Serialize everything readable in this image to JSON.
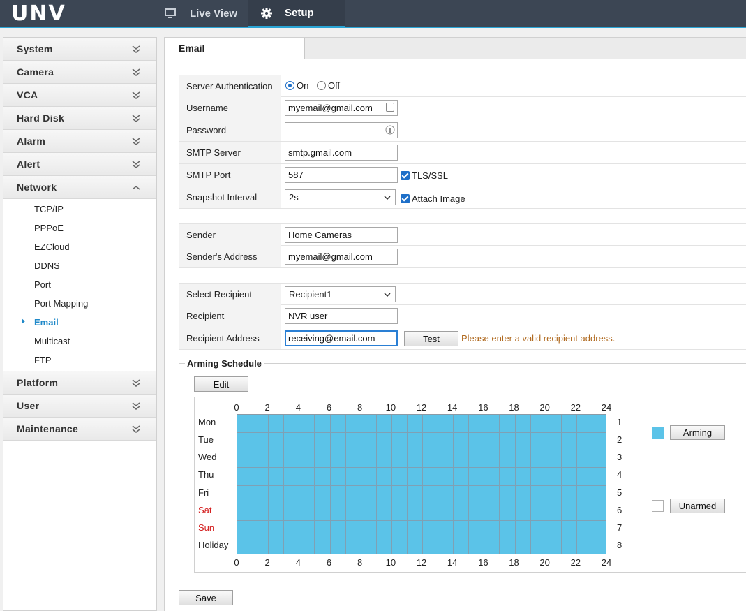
{
  "brand": "UNV",
  "topnav": {
    "live_view": "Live View",
    "setup": "Setup"
  },
  "sidebar": {
    "sections": [
      {
        "label": "System",
        "expanded": false
      },
      {
        "label": "Camera",
        "expanded": false
      },
      {
        "label": "VCA",
        "expanded": false
      },
      {
        "label": "Hard Disk",
        "expanded": false
      },
      {
        "label": "Alarm",
        "expanded": false
      },
      {
        "label": "Alert",
        "expanded": false
      },
      {
        "label": "Network",
        "expanded": true
      }
    ],
    "network_items": [
      "TCP/IP",
      "PPPoE",
      "EZCloud",
      "DDNS",
      "Port",
      "Port Mapping",
      "Email",
      "Multicast",
      "FTP"
    ],
    "active_item": "Email",
    "sections_after": [
      {
        "label": "Platform"
      },
      {
        "label": "User"
      },
      {
        "label": "Maintenance"
      }
    ]
  },
  "tab": {
    "title": "Email"
  },
  "form": {
    "server_auth": {
      "label": "Server Authentication",
      "on": "On",
      "off": "Off",
      "selected": "On"
    },
    "username": {
      "label": "Username",
      "value": "myemail@gmail.com"
    },
    "password": {
      "label": "Password",
      "value": ""
    },
    "smtp_server": {
      "label": "SMTP Server",
      "value": "smtp.gmail.com"
    },
    "smtp_port": {
      "label": "SMTP Port",
      "value": "587",
      "tls_label": "TLS/SSL",
      "tls_checked": true
    },
    "snapshot": {
      "label": "Snapshot Interval",
      "value": "2s",
      "attach_label": "Attach Image",
      "attach_checked": true
    },
    "sender": {
      "label": "Sender",
      "value": "Home Cameras"
    },
    "sender_address": {
      "label": "Sender's Address",
      "value": "myemail@gmail.com"
    },
    "select_recipient": {
      "label": "Select Recipient",
      "value": "Recipient1"
    },
    "recipient": {
      "label": "Recipient",
      "value": "NVR user"
    },
    "recipient_address": {
      "label": "Recipient Address",
      "value": "receiving@email.com",
      "test_label": "Test",
      "warning": "Please enter a valid recipient address."
    }
  },
  "arming": {
    "title": "Arming Schedule",
    "edit_label": "Edit",
    "hours": [
      "0",
      "2",
      "4",
      "6",
      "8",
      "10",
      "12",
      "14",
      "16",
      "18",
      "20",
      "22",
      "24"
    ],
    "days": [
      {
        "name": "Mon",
        "num": "1",
        "weekend": false
      },
      {
        "name": "Tue",
        "num": "2",
        "weekend": false
      },
      {
        "name": "Wed",
        "num": "3",
        "weekend": false
      },
      {
        "name": "Thu",
        "num": "4",
        "weekend": false
      },
      {
        "name": "Fri",
        "num": "5",
        "weekend": false
      },
      {
        "name": "Sat",
        "num": "6",
        "weekend": true
      },
      {
        "name": "Sun",
        "num": "7",
        "weekend": true
      },
      {
        "name": "Holiday",
        "num": "8",
        "weekend": false
      }
    ],
    "armed_fraction": 1.0,
    "arming_label": "Arming",
    "unarmed_label": "Unarmed",
    "armed_color": "#5bc3e8",
    "weekend_color": "#d42020"
  },
  "save_label": "Save"
}
